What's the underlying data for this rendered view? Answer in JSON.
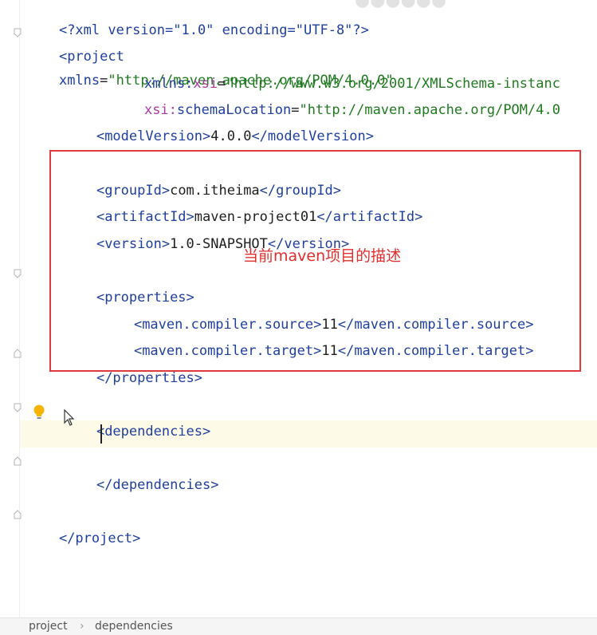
{
  "xml": {
    "prolog": "<?xml version=\"1.0\" encoding=\"UTF-8\"?>",
    "project_open": "<project",
    "xmlns_attr": "xmlns",
    "xmlns_val": "\"http://maven.apache.org/POM/4.0.0\"",
    "xsi_prefix": "xmlns:",
    "xsi_name": "xsi",
    "xsi_val": "\"http://www.w3.org/2001/XMLSchema-instanc",
    "schema_prefix": "xsi:",
    "schema_name": "schemaLocation",
    "schema_val": "\"http://maven.apache.org/POM/4.0",
    "model_open": "<modelVersion>",
    "model_value": "4.0.0",
    "model_close": "</modelVersion>",
    "group_open": "<groupId>",
    "group_value": "com.itheima",
    "group_close": "</groupId>",
    "artifact_open": "<artifactId>",
    "artifact_value": "maven-project01",
    "artifact_close": "</artifactId>",
    "version_open": "<version>",
    "version_value": "1.0-SNAPSHOT",
    "version_close": "</version>",
    "props_open": "<properties>",
    "source_open": "<maven.compiler.source>",
    "source_value": "11",
    "source_close": "</maven.compiler.source>",
    "target_open": "<maven.compiler.target>",
    "target_value": "11",
    "target_close": "</maven.compiler.target>",
    "props_close": "</properties>",
    "deps_open": "<dependencies>",
    "deps_close": "</dependencies>",
    "project_close": "</project>"
  },
  "annotation": "当前maven项目的描述",
  "statusbar": {
    "crumb1": "project",
    "separator": "›",
    "crumb2": "dependencies"
  },
  "colors": {
    "tag": "#1f3f9e",
    "namespace": "#a93aa0",
    "string": "#1f7a1f",
    "annotation": "#e32d2d",
    "box": "#e0393e",
    "caret_row": "#fdfbe8"
  },
  "icons": [
    "fold-icon",
    "lightbulb-icon",
    "mouse-pointer-icon"
  ]
}
